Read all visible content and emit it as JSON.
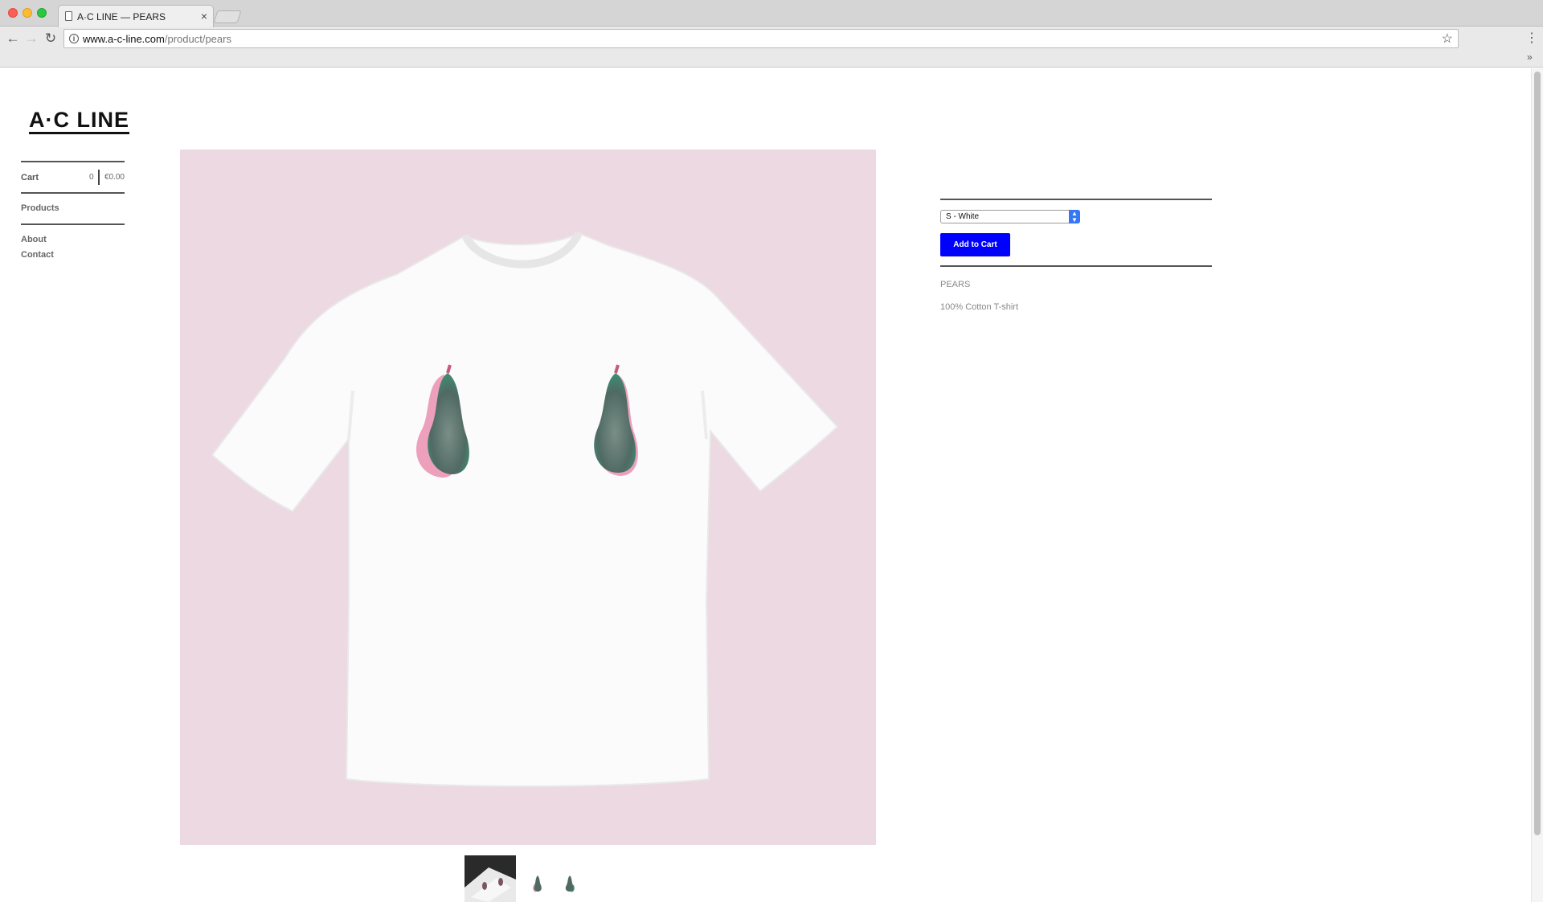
{
  "browser": {
    "tab_title": "A·C LINE — PEARS",
    "tab_close": "×",
    "url_host": "www.a-c-line.com",
    "url_path": "/product/pears",
    "back": "←",
    "forward": "→",
    "reload": "↻",
    "star": "☆",
    "menu": "⋮",
    "overflow": "»",
    "info": "i"
  },
  "site": {
    "logo": "A·C LINE"
  },
  "sidebar": {
    "cart_label": "Cart",
    "cart_count": "0",
    "cart_total": "€0.00",
    "products": "Products",
    "about": "About",
    "contact": "Contact"
  },
  "product": {
    "size_selected": "S - White",
    "add_to_cart": "Add to Cart",
    "name": "PEARS",
    "description": "100% Cotton T-shirt",
    "thumbnail_count": 3
  },
  "colors": {
    "accent": "#0000ff",
    "hero_background": "#ecd9e1",
    "select_arrow": "#3478f6"
  },
  "icons": {
    "tab_icon": "page-icon",
    "info_icon": "info-icon",
    "bookmark": "star-icon",
    "select_arrow": "chevron-updown-icon"
  }
}
